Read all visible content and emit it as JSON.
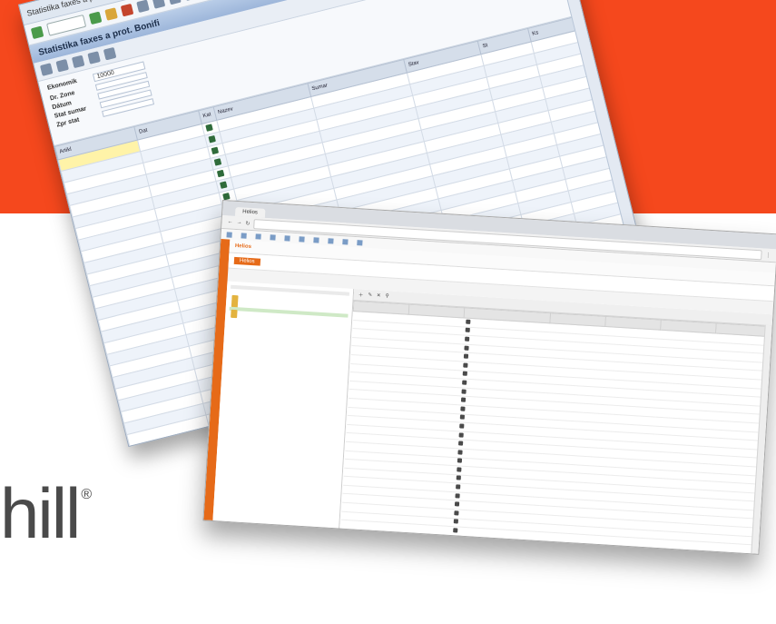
{
  "brand": {
    "text": "hill",
    "mark": "®"
  },
  "colors": {
    "band": "#f5481d",
    "helios_accent": "#e66a18",
    "sap_header": "#9db6da"
  },
  "sap": {
    "window_title": "Statistika faxes a prot. Bonifi",
    "app_title": "Statistika faxes a prot. Bonifi",
    "form": [
      {
        "label": "Ekonomik",
        "value": "10000"
      },
      {
        "label": "Dr. Zone",
        "value": ""
      },
      {
        "label": "Dátum",
        "value": ""
      },
      {
        "label": "Stat sumar",
        "value": ""
      },
      {
        "label": "Zpr stat",
        "value": ""
      }
    ],
    "columns": [
      "Artikl",
      "Dat",
      "Kat",
      "Nazev",
      "Sumar",
      "Stav",
      "St",
      "Ks"
    ],
    "rows": [
      [
        "",
        "",
        "",
        "",
        "",
        "",
        "",
        ""
      ],
      [
        "",
        "",
        "",
        "",
        "",
        "",
        "",
        ""
      ],
      [
        "",
        "",
        "",
        "",
        "",
        "",
        "",
        ""
      ],
      [
        "",
        "",
        "",
        "",
        "",
        "",
        "",
        ""
      ],
      [
        "",
        "",
        "",
        "",
        "",
        "",
        "",
        ""
      ],
      [
        "",
        "",
        "",
        "",
        "",
        "",
        "",
        ""
      ],
      [
        "",
        "",
        "",
        "",
        "",
        "",
        "",
        ""
      ],
      [
        "",
        "",
        "",
        "",
        "",
        "",
        "",
        ""
      ],
      [
        "",
        "",
        "",
        "",
        "",
        "",
        "",
        ""
      ],
      [
        "",
        "",
        "",
        "",
        "",
        "",
        "",
        ""
      ],
      [
        "",
        "",
        "",
        "",
        "",
        "",
        "",
        ""
      ],
      [
        "",
        "",
        "",
        "",
        "",
        "",
        "",
        ""
      ],
      [
        "",
        "",
        "",
        "",
        "",
        "",
        "",
        ""
      ],
      [
        "",
        "",
        "",
        "",
        "",
        "",
        "",
        ""
      ],
      [
        "",
        "",
        "",
        "",
        "",
        "",
        "",
        ""
      ],
      [
        "",
        "",
        "",
        "",
        "",
        "",
        "",
        ""
      ],
      [
        "",
        "",
        "",
        "",
        "",
        "",
        "",
        ""
      ],
      [
        "",
        "",
        "",
        "",
        "",
        "",
        "",
        ""
      ],
      [
        "",
        "",
        "",
        "",
        "",
        "",
        "",
        ""
      ],
      [
        "",
        "",
        "",
        "",
        "",
        "",
        "",
        ""
      ],
      [
        "",
        "",
        "",
        "",
        "",
        "",
        "",
        ""
      ],
      [
        "",
        "",
        "",
        "",
        "",
        "",
        "",
        ""
      ],
      [
        "",
        "",
        "",
        "",
        "",
        "",
        "",
        ""
      ],
      [
        "",
        "",
        "",
        "",
        "",
        "",
        "",
        ""
      ],
      [
        "",
        "",
        "",
        "",
        "",
        "",
        "",
        ""
      ],
      [
        "",
        "",
        "",
        "",
        "",
        "",
        "",
        ""
      ],
      [
        "",
        "",
        "",
        "",
        "",
        "",
        "",
        ""
      ],
      [
        "",
        "",
        "",
        "",
        "",
        "",
        "",
        ""
      ],
      [
        "",
        "",
        "",
        "",
        "",
        "",
        "",
        ""
      ],
      [
        "",
        "",
        "",
        "",
        "",
        "",
        "",
        ""
      ]
    ]
  },
  "helios": {
    "tab": "Helios",
    "url": "",
    "bookmarks": [
      "",
      "",
      "",
      "",
      "",
      "",
      "",
      "",
      "",
      ""
    ],
    "app_name": "Helios",
    "breadcrumb": "Helios",
    "tree_header": "",
    "tree": [
      "",
      "",
      "",
      "",
      "",
      ""
    ],
    "columns": [
      "",
      "",
      "",
      "",
      "",
      "",
      ""
    ],
    "rows_count": 34
  }
}
